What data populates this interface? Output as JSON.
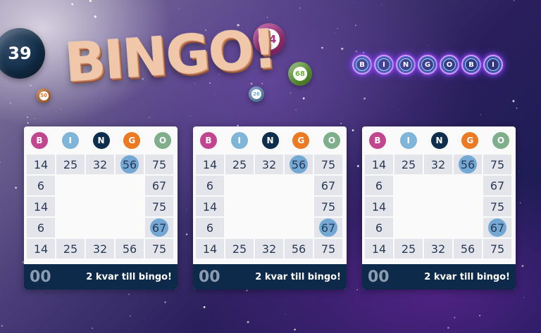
{
  "logo": {
    "text": "BINGO!"
  },
  "neon_logo": {
    "letters": [
      "B",
      "I",
      "N",
      "G",
      "O",
      "B",
      "I"
    ]
  },
  "drawn_balls": [
    {
      "number": "39",
      "color": "#12304c"
    },
    {
      "number": "14",
      "color": "#b4358a"
    },
    {
      "number": "68",
      "color": "#6bb03a"
    },
    {
      "number": "26",
      "color": "#6ea6dc"
    },
    {
      "number": "50",
      "color": "#ec7a22"
    }
  ],
  "letter_colors": {
    "B": "#c2458f",
    "I": "#7fb5d8",
    "N": "#0f2e4d",
    "G": "#ec7a22",
    "O": "#7fae8a"
  },
  "cards": [
    {
      "header": [
        "B",
        "I",
        "N",
        "G",
        "O"
      ],
      "rows": [
        [
          "14",
          "25",
          "32",
          "56",
          "75"
        ],
        [
          "6",
          "",
          "",
          "",
          "67"
        ],
        [
          "14",
          "",
          "",
          "",
          "75"
        ],
        [
          "6",
          "",
          "",
          "",
          "67"
        ],
        [
          "14",
          "25",
          "32",
          "56",
          "75"
        ]
      ],
      "count": "00",
      "status": "2 kvar till bingo!"
    },
    {
      "header": [
        "B",
        "I",
        "N",
        "G",
        "O"
      ],
      "rows": [
        [
          "14",
          "25",
          "32",
          "56",
          "75"
        ],
        [
          "6",
          "",
          "",
          "",
          "67"
        ],
        [
          "14",
          "",
          "",
          "",
          "75"
        ],
        [
          "6",
          "",
          "",
          "",
          "67"
        ],
        [
          "14",
          "25",
          "32",
          "56",
          "75"
        ]
      ],
      "count": "00",
      "status": "2 kvar till bingo!"
    },
    {
      "header": [
        "B",
        "I",
        "N",
        "G",
        "O"
      ],
      "rows": [
        [
          "14",
          "25",
          "32",
          "56",
          "75"
        ],
        [
          "6",
          "",
          "",
          "",
          "67"
        ],
        [
          "14",
          "",
          "",
          "",
          "75"
        ],
        [
          "6",
          "",
          "",
          "",
          "67"
        ],
        [
          "14",
          "25",
          "32",
          "56",
          "75"
        ]
      ],
      "count": "00",
      "status": "2 kvar till bingo!"
    }
  ],
  "marked_numbers": [
    "56",
    "67"
  ]
}
